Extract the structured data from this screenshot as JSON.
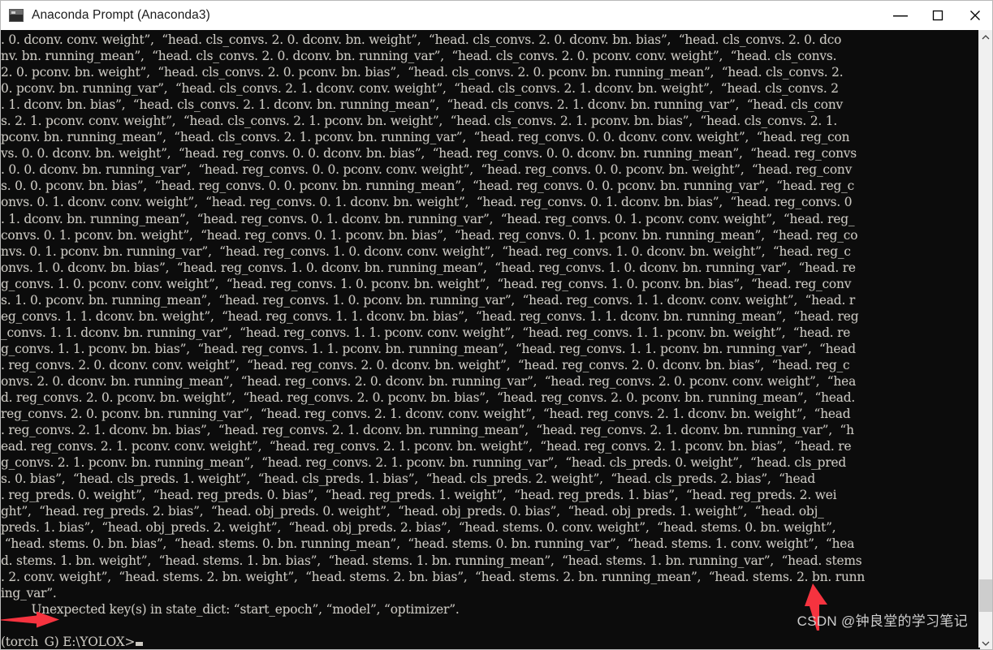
{
  "window": {
    "title": "Anaconda Prompt (Anaconda3)",
    "app_icon": "terminal-icon",
    "controls": {
      "minimize": "minimize-icon",
      "maximize": "maximize-icon",
      "close": "close-icon"
    },
    "titlebar_bg": "#ffffff",
    "console_bg": "#0c0c0c",
    "console_fg": "#ccc9c2"
  },
  "annotations": {
    "arrow_color": "#f5333f",
    "arrow_right_name": "red-arrow-pointing-right",
    "arrow_up_name": "red-arrow-pointing-up",
    "watermark": "CSDN @钟良堂的学习笔记"
  },
  "scrollbar": {
    "up_glyph": "˄",
    "down_glyph": "˅",
    "thumb_position": "near-bottom"
  },
  "console": {
    "prompt": "(torch_G) E:\\YOLOX>",
    "cursor": "▄",
    "error_line": "        Unexpected key(s) in state_dict: “start_epoch”, “model”, “optimizer”.",
    "lines": [
      ". 0. dconv. conv. weight”,  “head. cls_convs. 2. 0. dconv. bn. weight”,  “head. cls_convs. 2. 0. dconv. bn. bias”,  “head. cls_convs. 2. 0. dco",
      "nv. bn. running_mean”,  “head. cls_convs. 2. 0. dconv. bn. running_var”,  “head. cls_convs. 2. 0. pconv. conv. weight”,  “head. cls_convs.",
      "2. 0. pconv. bn. weight”,  “head. cls_convs. 2. 0. pconv. bn. bias”,  “head. cls_convs. 2. 0. pconv. bn. running_mean”,  “head. cls_convs. 2.",
      "0. pconv. bn. running_var”,  “head. cls_convs. 2. 1. dconv. conv. weight”,  “head. cls_convs. 2. 1. dconv. bn. weight”,  “head. cls_convs. 2",
      ". 1. dconv. bn. bias”,  “head. cls_convs. 2. 1. dconv. bn. running_mean”,  “head. cls_convs. 2. 1. dconv. bn. running_var”,  “head. cls_conv",
      "s. 2. 1. pconv. conv. weight”,  “head. cls_convs. 2. 1. pconv. bn. weight”,  “head. cls_convs. 2. 1. pconv. bn. bias”,  “head. cls_convs. 2. 1.",
      "pconv. bn. running_mean”,  “head. cls_convs. 2. 1. pconv. bn. running_var”,  “head. reg_convs. 0. 0. dconv. conv. weight”,  “head. reg_con",
      "vs. 0. 0. dconv. bn. weight”,  “head. reg_convs. 0. 0. dconv. bn. bias”,  “head. reg_convs. 0. 0. dconv. bn. running_mean”,  “head. reg_convs",
      ". 0. 0. dconv. bn. running_var”,  “head. reg_convs. 0. 0. pconv. conv. weight”,  “head. reg_convs. 0. 0. pconv. bn. weight”,  “head. reg_conv",
      "s. 0. 0. pconv. bn. bias”,  “head. reg_convs. 0. 0. pconv. bn. running_mean”,  “head. reg_convs. 0. 0. pconv. bn. running_var”,  “head. reg_c",
      "onvs. 0. 1. dconv. conv. weight”,  “head. reg_convs. 0. 1. dconv. bn. weight”,  “head. reg_convs. 0. 1. dconv. bn. bias”,  “head. reg_convs. 0",
      ". 1. dconv. bn. running_mean”,  “head. reg_convs. 0. 1. dconv. bn. running_var”,  “head. reg_convs. 0. 1. pconv. conv. weight”,  “head. reg_",
      "convs. 0. 1. pconv. bn. weight”,  “head. reg_convs. 0. 1. pconv. bn. bias”,  “head. reg_convs. 0. 1. pconv. bn. running_mean”,  “head. reg_co",
      "nvs. 0. 1. pconv. bn. running_var”,  “head. reg_convs. 1. 0. dconv. conv. weight”,  “head. reg_convs. 1. 0. dconv. bn. weight”,  “head. reg_c",
      "onvs. 1. 0. dconv. bn. bias”,  “head. reg_convs. 1. 0. dconv. bn. running_mean”,  “head. reg_convs. 1. 0. dconv. bn. running_var”,  “head. re",
      "g_convs. 1. 0. pconv. conv. weight”,  “head. reg_convs. 1. 0. pconv. bn. weight”,  “head. reg_convs. 1. 0. pconv. bn. bias”,  “head. reg_conv",
      "s. 1. 0. pconv. bn. running_mean”,  “head. reg_convs. 1. 0. pconv. bn. running_var”,  “head. reg_convs. 1. 1. dconv. conv. weight”,  “head. r",
      "eg_convs. 1. 1. dconv. bn. weight”,  “head. reg_convs. 1. 1. dconv. bn. bias”,  “head. reg_convs. 1. 1. dconv. bn. running_mean”,  “head. reg",
      "_convs. 1. 1. dconv. bn. running_var”,  “head. reg_convs. 1. 1. pconv. conv. weight”,  “head. reg_convs. 1. 1. pconv. bn. weight”,  “head. re",
      "g_convs. 1. 1. pconv. bn. bias”,  “head. reg_convs. 1. 1. pconv. bn. running_mean”,  “head. reg_convs. 1. 1. pconv. bn. running_var”,  “head",
      ". reg_convs. 2. 0. dconv. conv. weight”,  “head. reg_convs. 2. 0. dconv. bn. weight”,  “head. reg_convs. 2. 0. dconv. bn. bias”,  “head. reg_c",
      "onvs. 2. 0. dconv. bn. running_mean”,  “head. reg_convs. 2. 0. dconv. bn. running_var”,  “head. reg_convs. 2. 0. pconv. conv. weight”,  “hea",
      "d. reg_convs. 2. 0. pconv. bn. weight”,  “head. reg_convs. 2. 0. pconv. bn. bias”,  “head. reg_convs. 2. 0. pconv. bn. running_mean”,  “head.",
      "reg_convs. 2. 0. pconv. bn. running_var”,  “head. reg_convs. 2. 1. dconv. conv. weight”,  “head. reg_convs. 2. 1. dconv. bn. weight”,  “head",
      ". reg_convs. 2. 1. dconv. bn. bias”,  “head. reg_convs. 2. 1. dconv. bn. running_mean”,  “head. reg_convs. 2. 1. dconv. bn. running_var”,  “h",
      "ead. reg_convs. 2. 1. pconv. conv. weight”,  “head. reg_convs. 2. 1. pconv. bn. weight”,  “head. reg_convs. 2. 1. pconv. bn. bias”,  “head. re",
      "g_convs. 2. 1. pconv. bn. running_mean”,  “head. reg_convs. 2. 1. pconv. bn. running_var”,  “head. cls_preds. 0. weight”,  “head. cls_pred",
      "s. 0. bias”,  “head. cls_preds. 1. weight”,  “head. cls_preds. 1. bias”,  “head. cls_preds. 2. weight”,  “head. cls_preds. 2. bias”,  “head",
      ". reg_preds. 0. weight”,  “head. reg_preds. 0. bias”,  “head. reg_preds. 1. weight”,  “head. reg_preds. 1. bias”,  “head. reg_preds. 2. wei",
      "ght”,  “head. reg_preds. 2. bias”,  “head. obj_preds. 0. weight”,  “head. obj_preds. 0. bias”,  “head. obj_preds. 1. weight”,  “head. obj_",
      "preds. 1. bias”,  “head. obj_preds. 2. weight”,  “head. obj_preds. 2. bias”,  “head. stems. 0. conv. weight”,  “head. stems. 0. bn. weight”,",
      " “head. stems. 0. bn. bias”,  “head. stems. 0. bn. running_mean”,  “head. stems. 0. bn. running_var”,  “head. stems. 1. conv. weight”,  “hea",
      "d. stems. 1. bn. weight”,  “head. stems. 1. bn. bias”,  “head. stems. 1. bn. running_mean”,  “head. stems. 1. bn. running_var”,  “head. stems",
      ". 2. conv. weight”,  “head. stems. 2. bn. weight”,  “head. stems. 2. bn. bias”,  “head. stems. 2. bn. running_mean”,  “head. stems. 2. bn. runn",
      "ing_var”."
    ]
  }
}
